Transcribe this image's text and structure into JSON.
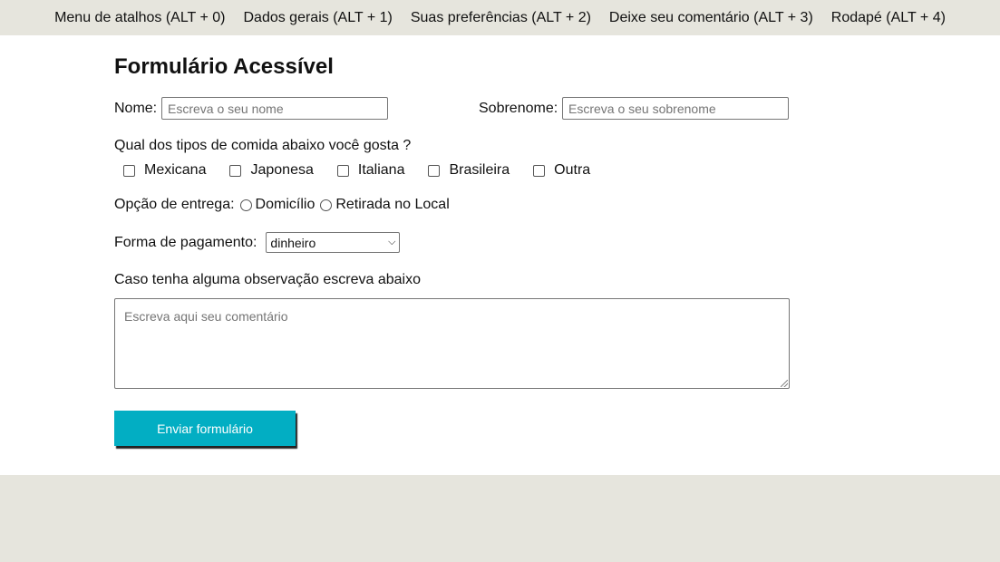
{
  "nav": {
    "items": [
      {
        "label": "Menu de atalhos (ALT + 0)"
      },
      {
        "label": "Dados gerais (ALT + 1)"
      },
      {
        "label": "Suas preferências (ALT + 2)"
      },
      {
        "label": "Deixe seu comentário (ALT + 3)"
      },
      {
        "label": "Rodapé (ALT + 4)"
      }
    ]
  },
  "form": {
    "title": "Formulário Acessível",
    "name": {
      "label": "Nome:",
      "placeholder": "Escreva o seu nome",
      "value": ""
    },
    "surname": {
      "label": "Sobrenome:",
      "placeholder": "Escreva o seu sobrenome",
      "value": ""
    },
    "food_question": "Qual dos tipos de comida abaixo você gosta ?",
    "foods": [
      {
        "label": "Mexicana",
        "checked": false
      },
      {
        "label": "Japonesa",
        "checked": false
      },
      {
        "label": "Italiana",
        "checked": false
      },
      {
        "label": "Brasileira",
        "checked": false
      },
      {
        "label": "Outra",
        "checked": false
      }
    ],
    "delivery": {
      "label": "Opção de entrega:",
      "options": [
        {
          "label": "Domicílio",
          "selected": false
        },
        {
          "label": "Retirada no Local",
          "selected": false
        }
      ]
    },
    "payment": {
      "label": "Forma de pagamento:",
      "selected": "dinheiro"
    },
    "observation_label": "Caso tenha alguma observação escreva abaixo",
    "comment_placeholder": "Escreva aqui seu comentário",
    "submit_label": "Enviar formulário"
  },
  "colors": {
    "background": "#e6e5dd",
    "accent": "#02aec3",
    "panel": "#ffffff"
  }
}
